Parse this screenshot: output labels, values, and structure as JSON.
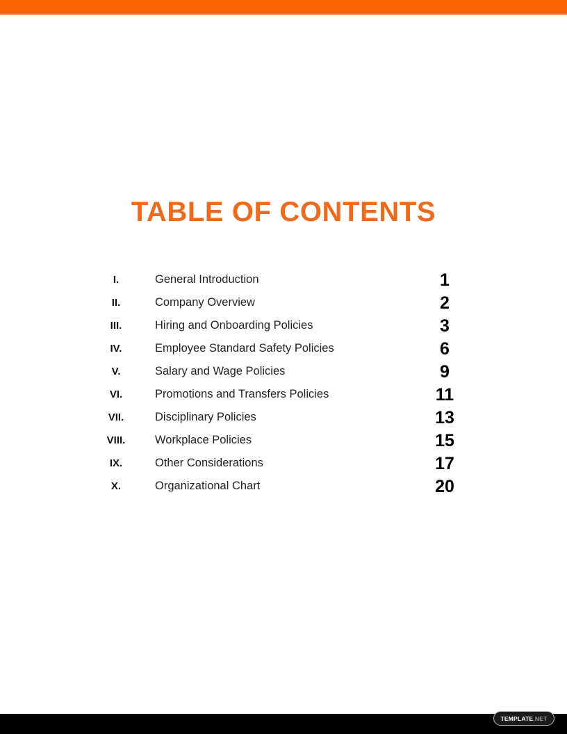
{
  "document": {
    "title": "TABLE OF CONTENTS",
    "background_color": "#FFFFFF"
  },
  "bands": {
    "top_bar_color": "#FA6400",
    "bottom_bar_color": "#000000"
  },
  "theme": {
    "accent_orange": "#EC6B1E",
    "text_color": "#231F20",
    "page_number_color": "#000000"
  },
  "contents": {
    "entries": [
      {
        "numeral": "I.",
        "label": "General Introduction",
        "page": "1"
      },
      {
        "numeral": "II.",
        "label": "Company Overview",
        "page": "2"
      },
      {
        "numeral": "III.",
        "label": "Hiring and Onboarding Policies",
        "page": "3"
      },
      {
        "numeral": "IV.",
        "label": "Employee Standard Safety Policies",
        "page": "6"
      },
      {
        "numeral": "V.",
        "label": "Salary and Wage Policies",
        "page": "9"
      },
      {
        "numeral": "VI.",
        "label": "Promotions and Transfers Policies",
        "page": "11"
      },
      {
        "numeral": "VII.",
        "label": "Disciplinary Policies",
        "page": "13"
      },
      {
        "numeral": "VIII.",
        "label": "Workplace Policies",
        "page": "15"
      },
      {
        "numeral": "IX.",
        "label": "Other Considerations",
        "page": "17"
      },
      {
        "numeral": "X.",
        "label": "Organizational Chart",
        "page": "20"
      }
    ]
  },
  "watermark": {
    "main": "TEMPLATE",
    "tld": ".NET"
  }
}
